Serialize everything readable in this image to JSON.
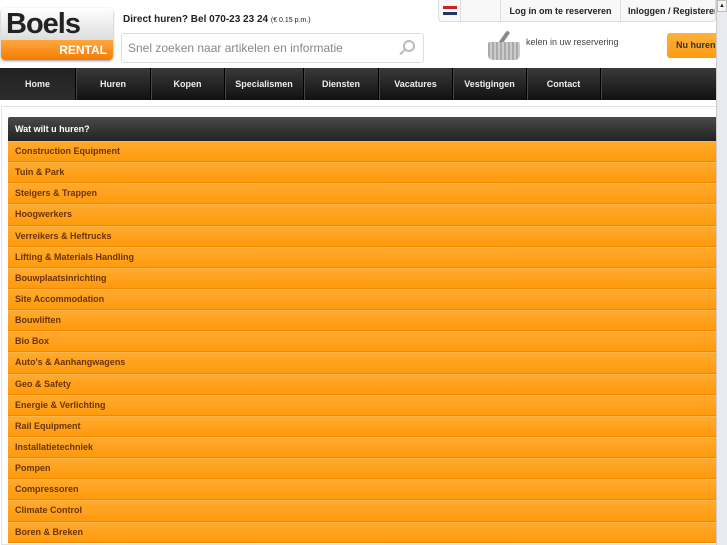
{
  "logo": {
    "brand": "Boels",
    "sub": "RENTAL"
  },
  "phone": {
    "text": "Direct huren? Bel 070-23 23 24",
    "note": "(€ 0.15 p.m.)"
  },
  "search": {
    "placeholder": "Snel zoeken naar artikelen en informatie"
  },
  "topbar": {
    "login_reserve": "Log in om te reserveren",
    "login_register": "Inloggen / Registeren"
  },
  "basket": {
    "text": "kelen in uw reservering",
    "button": "Nu huren"
  },
  "nav": [
    "Home",
    "Huren",
    "Kopen",
    "Specialismen",
    "Diensten",
    "Vacatures",
    "Vestigingen",
    "Contact"
  ],
  "panel": {
    "title": "Wat wilt u huren?",
    "items": [
      "Construction Equipment",
      "Tuin & Park",
      "Steigers & Trappen",
      "Hoogwerkers",
      "Verreikers & Heftrucks",
      "Lifting & Materials Handling",
      "Bouwplaatsinrichting",
      "Site Accommodation",
      "Bouwliften",
      "Bio Box",
      "Auto's & Aanhangwagens",
      "Geo & Safety",
      "Energie & Verlichting",
      "Rail Equipment",
      "Installatietechniek",
      "Pompen",
      "Compressoren",
      "Climate Control",
      "Boren & Breken"
    ]
  },
  "colors": {
    "accent": "#ff9c10",
    "nav": "#1a1a1a"
  }
}
